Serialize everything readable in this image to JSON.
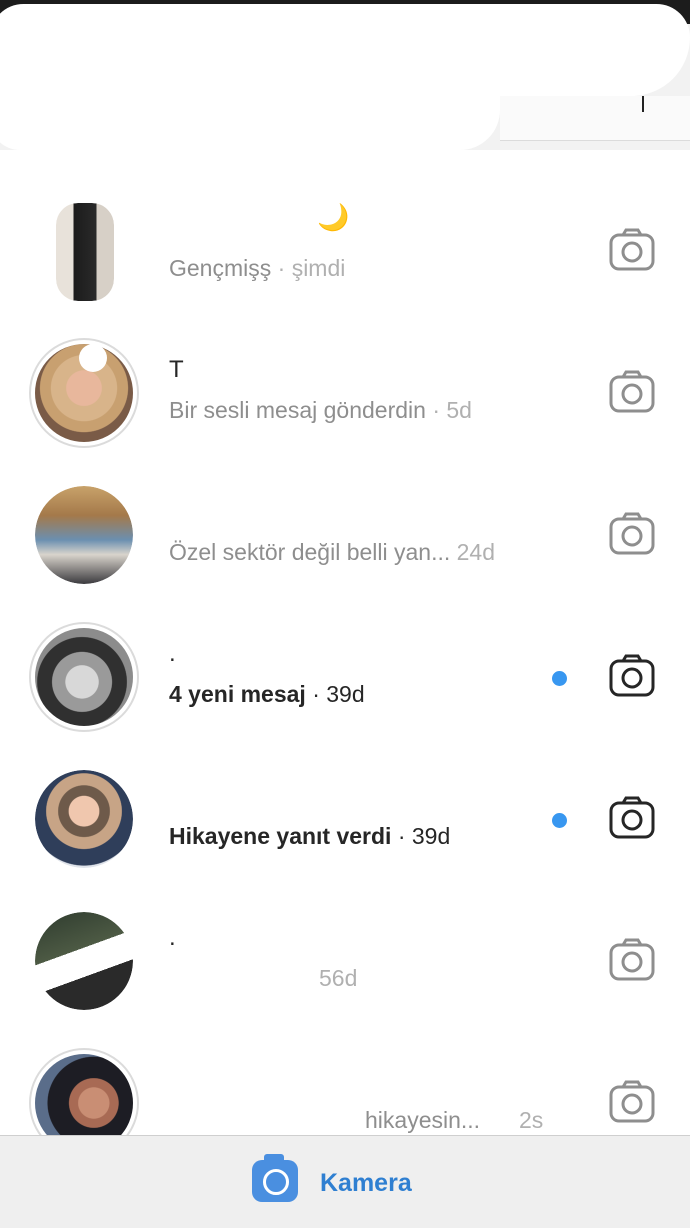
{
  "colors": {
    "accent": "#3897f0",
    "muted": "#8e8e8e",
    "text": "#262626",
    "camera_button": "#4a8fe0"
  },
  "threads": [
    {
      "name": "",
      "preview": "Gençmişş",
      "time": "· şimdi",
      "unread": false,
      "emoji": "🌙",
      "camera_icon": "camera-icon"
    },
    {
      "name": "T",
      "preview": "Bir sesli mesaj gönderdin",
      "time": "· 5d",
      "unread": false,
      "camera_icon": "camera-icon"
    },
    {
      "name": "",
      "preview": "Özel sektör değil belli yan...",
      "time": "24d",
      "unread": false,
      "camera_icon": "camera-icon"
    },
    {
      "name": ".",
      "preview": "4 yeni mesaj",
      "time": "· 39d",
      "unread": true,
      "camera_icon": "camera-icon"
    },
    {
      "name": "",
      "preview": "Hikayene yanıt verdi",
      "time": "· 39d",
      "unread": true,
      "camera_icon": "camera-icon"
    },
    {
      "name": ".",
      "preview": "",
      "time": "56d",
      "unread": false,
      "camera_icon": "camera-icon"
    },
    {
      "name": "",
      "preview": "hikayesin...",
      "time": "2s",
      "unread": false,
      "camera_icon": "camera-icon"
    }
  ],
  "bottom": {
    "camera_label": "Kamera",
    "icon": "camera-icon"
  }
}
